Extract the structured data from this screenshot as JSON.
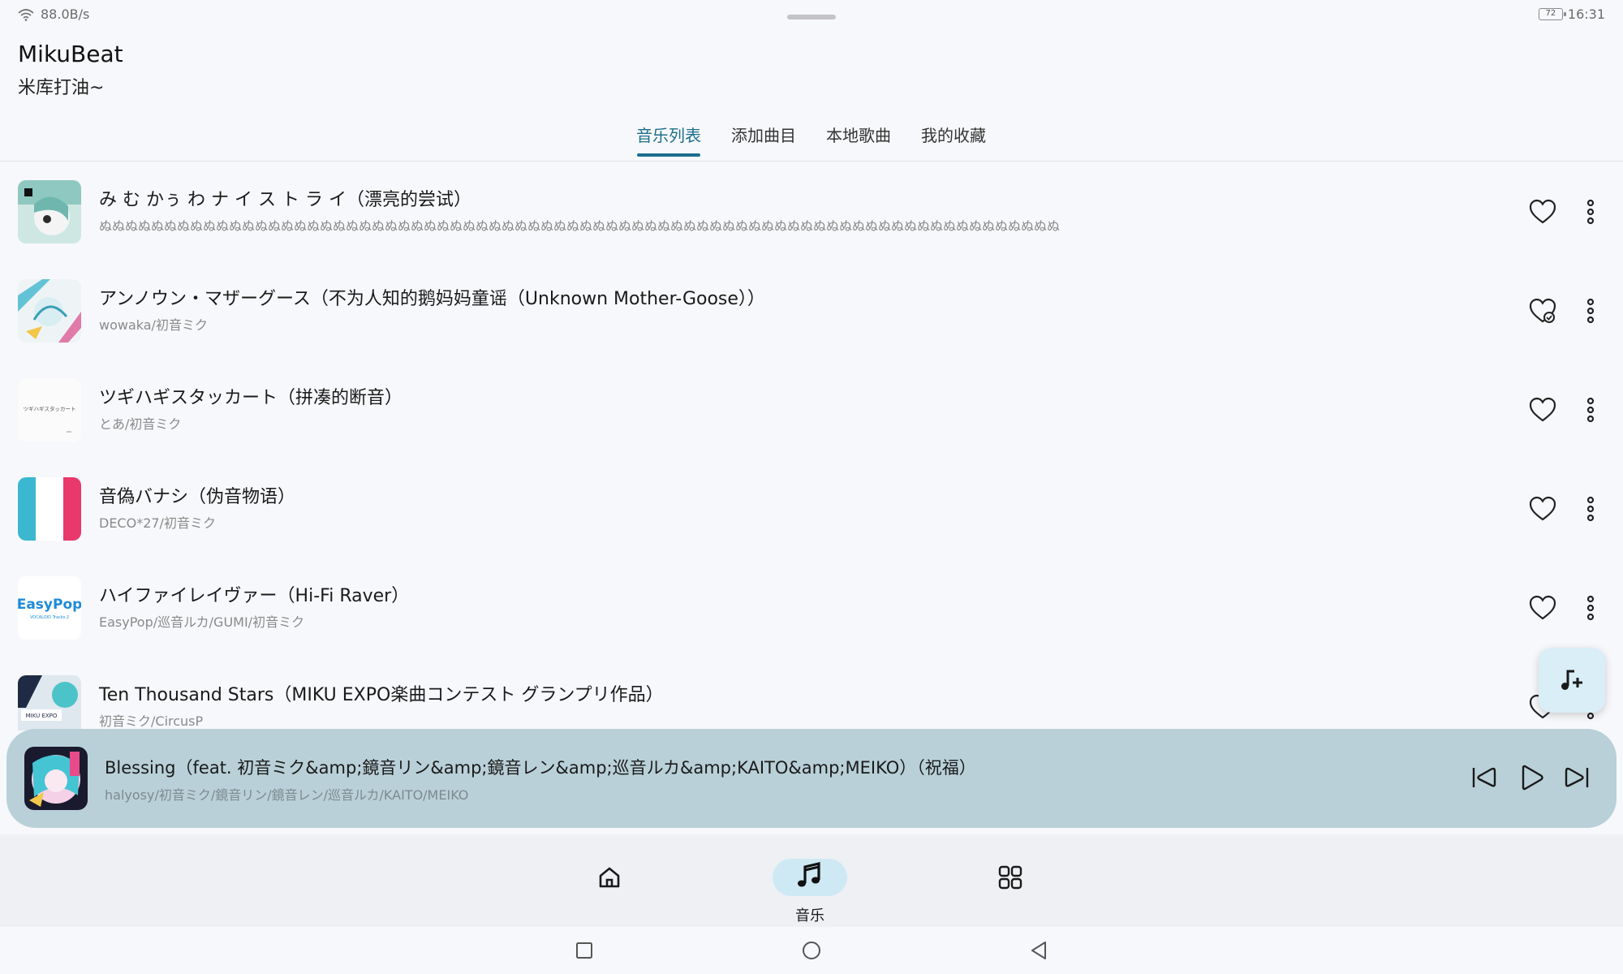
{
  "status_bar": {
    "network_speed": "88.0B/s",
    "battery_level": "72",
    "time": "16:31"
  },
  "app": {
    "title": "MikuBeat",
    "subtitle": "米库打油~"
  },
  "tabs": [
    {
      "label": "音乐列表",
      "active": true
    },
    {
      "label": "添加曲目",
      "active": false
    },
    {
      "label": "本地歌曲",
      "active": false
    },
    {
      "label": "我的收藏",
      "active": false
    }
  ],
  "songs": [
    {
      "title": "み む かぅ わ ナ イ ス ト ラ イ（漂亮的尝试）",
      "artist": "ぬぬぬぬぬぬぬぬぬぬぬぬぬぬぬぬぬぬぬぬぬぬぬぬぬぬぬぬぬぬぬぬぬぬぬぬぬぬぬぬぬぬぬぬぬぬぬぬぬぬぬぬぬぬぬぬぬぬぬぬぬぬぬぬぬぬぬぬぬぬぬぬぬぬ"
    },
    {
      "title": "アンノウン・マザーグース（不为人知的鹅妈妈童谣（Unknown Mother-Goose））",
      "artist": "wowaka/初音ミク"
    },
    {
      "title": "ツギハギスタッカート（拼凑的断音）",
      "artist": "とあ/初音ミク"
    },
    {
      "title": "音偽バナシ（伪音物语）",
      "artist": "DECO*27/初音ミク"
    },
    {
      "title": "ハイファイレイヴァー（Hi-Fi Raver）",
      "artist": "EasyPop/巡音ルカ/GUMI/初音ミク"
    },
    {
      "title": "Ten Thousand Stars（MIKU EXPO楽曲コンテスト グランプリ作品）",
      "artist": "初音ミク/CircusP"
    }
  ],
  "cover_text": {
    "song3": "ツギハギスタッカート",
    "song5_main": "EasyPop",
    "song5_sub": "VOCALOID Tracks 2",
    "song6": "MIKU EXPO"
  },
  "player": {
    "title": "Blessing（feat. 初音ミク&amp;鏡音リン&amp;鏡音レン&amp;巡音ルカ&amp;KAITO&amp;MEIKO）（祝福）",
    "artist": "halyosy/初音ミク/鏡音リン/鏡音レン/巡音ルカ/KAITO/MEIKO"
  },
  "bottom_nav": [
    {
      "icon": "home-icon",
      "label": ""
    },
    {
      "icon": "music-note-icon",
      "label": "音乐",
      "active": true
    },
    {
      "icon": "grid-icon",
      "label": ""
    }
  ],
  "colors": {
    "accent": "#1c6f8c",
    "player_bg": "#b9d0d8",
    "nav_pill": "#cfe9f4",
    "background": "#f7f8fb"
  }
}
